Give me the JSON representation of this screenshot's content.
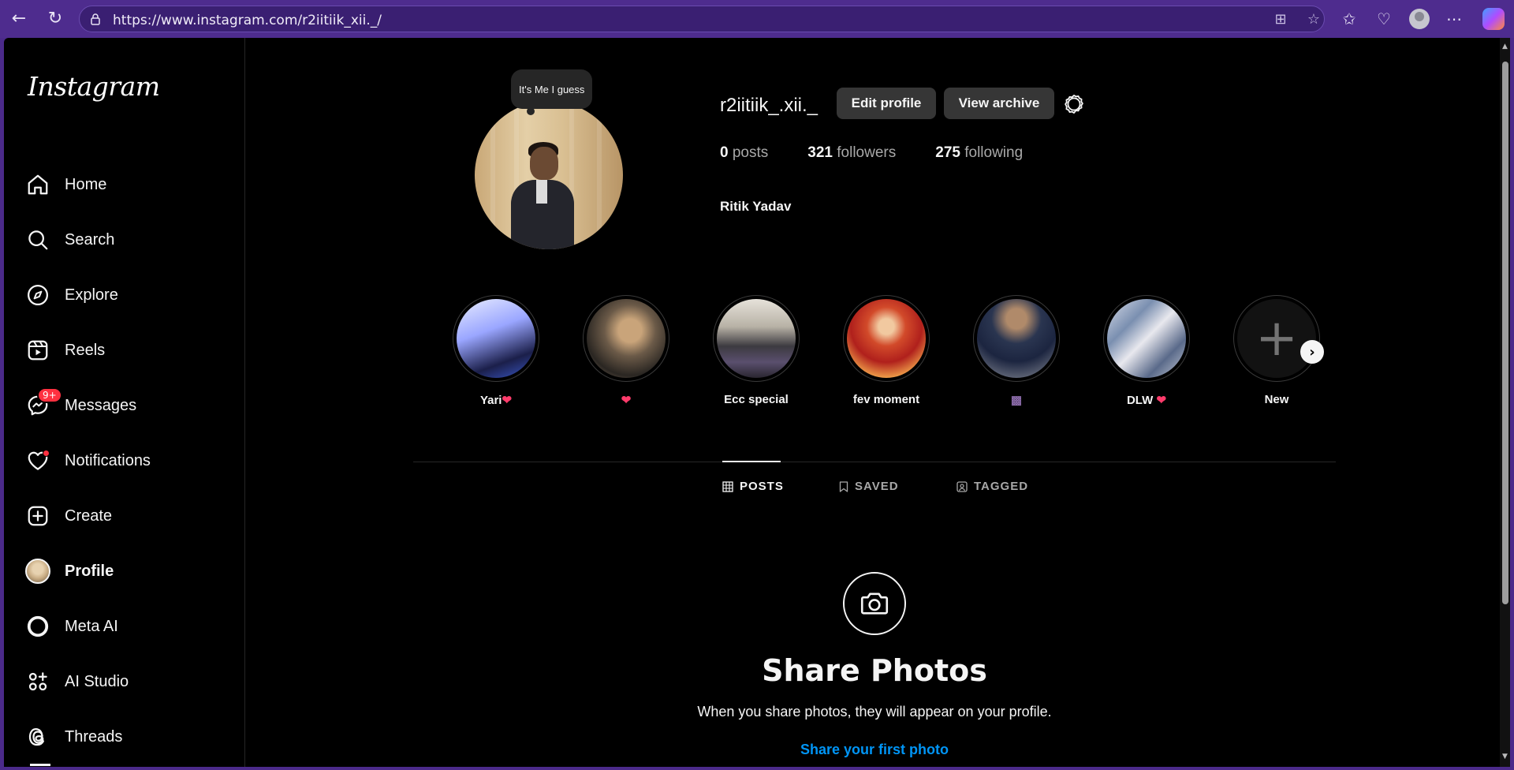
{
  "browser": {
    "url": "https://www.instagram.com/r2iitiik_xii._/"
  },
  "sidebar": {
    "logo": "Instagram",
    "items": [
      {
        "label": "Home",
        "icon": "home-icon"
      },
      {
        "label": "Search",
        "icon": "search-icon"
      },
      {
        "label": "Explore",
        "icon": "compass-icon"
      },
      {
        "label": "Reels",
        "icon": "reels-icon"
      },
      {
        "label": "Messages",
        "icon": "messenger-icon",
        "badge": "9+"
      },
      {
        "label": "Notifications",
        "icon": "heart-icon"
      },
      {
        "label": "Create",
        "icon": "plus-square-icon"
      },
      {
        "label": "Profile",
        "icon": "avatar"
      },
      {
        "label": "Meta AI",
        "icon": "meta-ai-ring-icon"
      },
      {
        "label": "AI Studio",
        "icon": "ai-studio-icon"
      },
      {
        "label": "Threads",
        "icon": "threads-icon"
      }
    ]
  },
  "profile": {
    "note": "It's Me I guess",
    "username": "r2iitiik_.xii._",
    "edit_label": "Edit profile",
    "archive_label": "View archive",
    "posts_count": "0",
    "posts_label": "posts",
    "followers_count": "321",
    "followers_label": "followers",
    "following_count": "275",
    "following_label": "following",
    "full_name": "Ritik Yadav"
  },
  "highlights": [
    {
      "label": "Yari",
      "heart": "❤"
    },
    {
      "label": "",
      "heart": "❤"
    },
    {
      "label": "Ecc special",
      "heart": ""
    },
    {
      "label": "fev moment",
      "heart": ""
    },
    {
      "label": "▩",
      "heart": ""
    },
    {
      "label": "DLW ",
      "heart": "❤"
    },
    {
      "label": "New",
      "heart": ""
    }
  ],
  "tabs": [
    {
      "label": "POSTS",
      "icon": "grid-icon"
    },
    {
      "label": "SAVED",
      "icon": "bookmark-icon"
    },
    {
      "label": "TAGGED",
      "icon": "tag-user-icon"
    }
  ],
  "empty_state": {
    "title": "Share Photos",
    "subtitle": "When you share photos, they will appear on your profile.",
    "link": "Share your first photo"
  },
  "colors": {
    "accent_link": "#0095f6",
    "badge_red": "#ff3040",
    "browser_frame": "#4e2c8e"
  }
}
